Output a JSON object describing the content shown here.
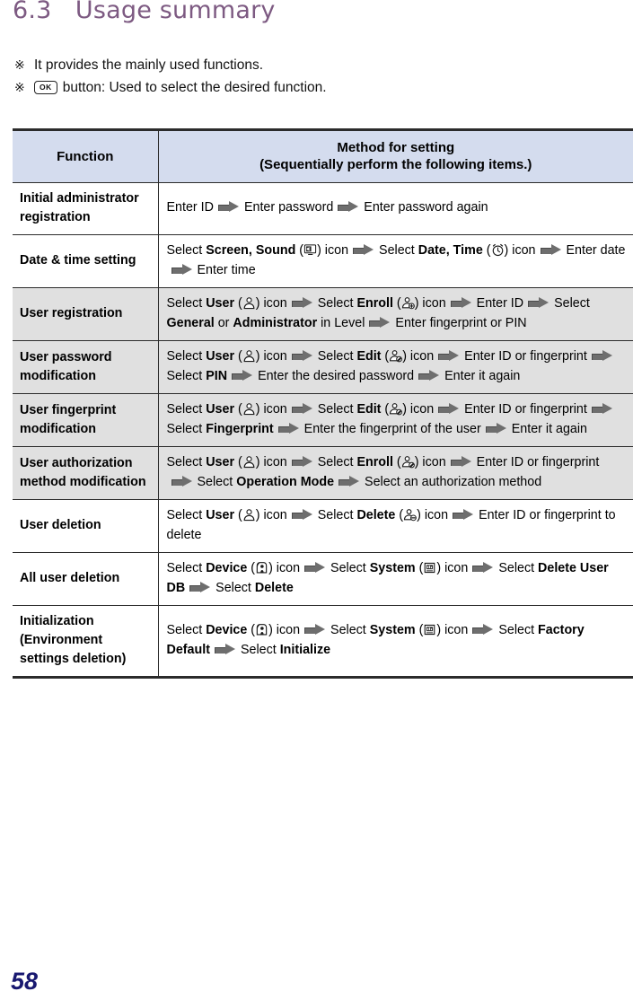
{
  "page": {
    "number": "58",
    "title": "6.3   Usage summary"
  },
  "notes": [
    {
      "mark": "※",
      "icon": null,
      "text": "It provides the mainly used functions."
    },
    {
      "mark": "※",
      "icon": "ok-key",
      "icon_label": "OK",
      "text": "button: Used to select the desired function."
    }
  ],
  "table": {
    "headers": {
      "function": "Function",
      "method_line1": "Method for setting",
      "method_line2": "(Sequentially perform the following items.)"
    },
    "rows": [
      {
        "function": "Initial administrator registration",
        "shaded": false,
        "steps": [
          {
            "text": "Enter ID"
          },
          {
            "text": "Enter password"
          },
          {
            "text": "Enter password again"
          }
        ]
      },
      {
        "function": "Date & time setting",
        "shaded": false,
        "steps": [
          {
            "pre": "Select ",
            "bold": "Screen, Sound",
            "icon": "screen-sound-icon",
            "post": " icon"
          },
          {
            "pre": "Select ",
            "bold": "Date, Time",
            "icon": "clock-icon",
            "post": " icon"
          },
          {
            "text": "Enter date"
          },
          {
            "text": "Enter time"
          }
        ]
      },
      {
        "function": "User registration",
        "shaded": true,
        "steps": [
          {
            "pre": "Select ",
            "bold": "User",
            "icon": "user-icon",
            "post": " icon"
          },
          {
            "pre": "Select ",
            "bold": "Enroll",
            "icon": "user-add-icon",
            "post": " icon"
          },
          {
            "text": "Enter ID"
          },
          {
            "pre": "Select ",
            "bold": "General",
            "mid": " or ",
            "bold2": "Administrator",
            "post": " in Level"
          },
          {
            "text": "Enter fingerprint or PIN"
          }
        ]
      },
      {
        "function": "User password modification",
        "shaded": true,
        "steps": [
          {
            "pre": "Select ",
            "bold": "User",
            "icon": "user-icon",
            "post": " icon"
          },
          {
            "pre": "Select ",
            "bold": "Edit",
            "icon": "user-edit-icon",
            "post": " icon"
          },
          {
            "text": "Enter ID or fingerprint"
          },
          {
            "pre": "Select ",
            "bold": "PIN"
          },
          {
            "text": "Enter the desired password"
          },
          {
            "text": "Enter it again"
          }
        ]
      },
      {
        "function": "User fingerprint modification",
        "shaded": true,
        "steps": [
          {
            "pre": "Select ",
            "bold": "User",
            "icon": "user-icon",
            "post": " icon"
          },
          {
            "pre": "Select ",
            "bold": "Edit",
            "icon": "user-edit-icon",
            "post": " icon"
          },
          {
            "text": "Enter ID or fingerprint"
          },
          {
            "pre": "Select ",
            "bold": "Fingerprint"
          },
          {
            "text": "Enter the fingerprint of the user"
          },
          {
            "text": "Enter it again"
          }
        ]
      },
      {
        "function": "User authorization method modification",
        "shaded": true,
        "steps": [
          {
            "pre": "Select ",
            "bold": "User",
            "icon": "user-icon",
            "post": " icon"
          },
          {
            "pre": "Select ",
            "bold": "Enroll",
            "icon": "user-edit-icon",
            "post": " icon"
          },
          {
            "text": "Enter ID or fingerprint"
          },
          {
            "pre": "Select ",
            "bold": "Operation Mode"
          },
          {
            "text": "Select an authorization method"
          }
        ]
      },
      {
        "function": "User deletion",
        "shaded": false,
        "steps": [
          {
            "pre": "Select ",
            "bold": "User",
            "icon": "user-icon",
            "post": " icon"
          },
          {
            "pre": "Select ",
            "bold": "Delete",
            "icon": "user-delete-icon",
            "post": " icon"
          },
          {
            "text": "Enter ID or fingerprint to delete"
          }
        ]
      },
      {
        "function": "All user deletion",
        "shaded": false,
        "steps": [
          {
            "pre": "Select ",
            "bold": "Device",
            "icon": "device-icon",
            "post": " icon"
          },
          {
            "pre": "Select ",
            "bold": "System",
            "icon": "system-icon",
            "post": " icon"
          },
          {
            "pre": "Select ",
            "bold": "Delete User DB"
          },
          {
            "pre": "Select ",
            "bold": "Delete"
          }
        ]
      },
      {
        "function": "Initialization (Environment settings deletion)",
        "shaded": false,
        "last": true,
        "steps": [
          {
            "pre": "Select ",
            "bold": "Device",
            "icon": "device-icon",
            "post": " icon"
          },
          {
            "pre": "Select ",
            "bold": "System",
            "icon": "system-icon",
            "post": " icon"
          },
          {
            "pre": "Select ",
            "bold": "Factory Default"
          },
          {
            "pre": "Select ",
            "bold": "Initialize"
          }
        ]
      }
    ]
  },
  "colors": {
    "title": "#7d5a82",
    "header_fill": "#d4dcee",
    "shaded_row": "#e0e0e0",
    "border": "#2b2b2b",
    "arrow": "#6e6e6e",
    "page_number": "#181870"
  }
}
